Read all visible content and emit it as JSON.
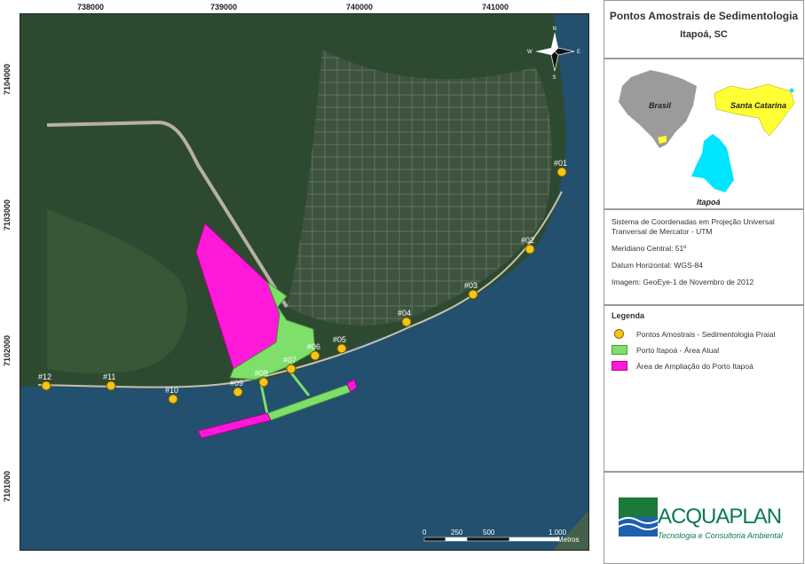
{
  "map": {
    "coords_top": [
      "738000",
      "739000",
      "740000",
      "741000"
    ],
    "coords_left": [
      "7104000",
      "7103000",
      "7102000",
      "7101000"
    ],
    "points": [
      "#01",
      "#02",
      "#03",
      "#04",
      "#05",
      "#06",
      "#07",
      "#08",
      "#09",
      "#10",
      "#11",
      "#12"
    ],
    "compass": {
      "n": "N",
      "s": "S",
      "e": "E",
      "w": "W"
    },
    "scale": {
      "ticks": [
        "0",
        "250",
        "500",
        "1.000"
      ],
      "unit": "Metros"
    },
    "colors": {
      "sea": "#1f4c6b",
      "land": "#2c4a2e",
      "current_area": "#7ee06a",
      "expansion_area": "#ff19d9",
      "point": "#f5c518"
    }
  },
  "panel": {
    "title": "Pontos Amostrais de Sedimentologia",
    "subtitle": "Itapoá, SC",
    "inset": {
      "brasil": "Brasil",
      "santa_catarina": "Santa Catarina",
      "itapoa": "Itapoá"
    },
    "info": {
      "coord_system": "Sistema de Coordenadas em Projeção Universal Tranversal de Mercator - UTM",
      "meridian": "Meridiano Central: 51º",
      "datum": "Datum Horizontal: WGS-84",
      "image": "Imagem: GeoEye-1 de Novembro de 2012"
    },
    "legend": {
      "title": "Legenda",
      "items": [
        "Pontos Amostrais - Sedimentologia Praial",
        "Porto Itapoá - Área Atual",
        "Área de Ampliação do Porto Itapoá"
      ]
    },
    "logo": {
      "name": "ACQUAPLAN",
      "tagline": "Tecnologia e Consultoria Ambiental"
    }
  }
}
